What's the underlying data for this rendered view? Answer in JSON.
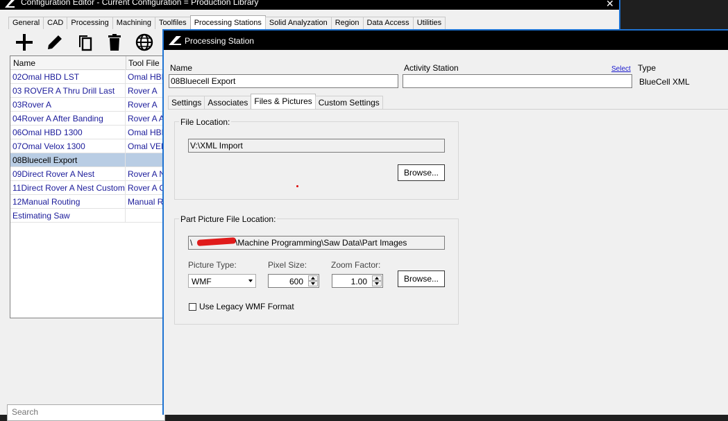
{
  "app": {
    "title": "Configuration Editor - Current Configuration = Production Library",
    "close_glyph": "✕"
  },
  "bg_tabs": [
    {
      "label": "General",
      "active": false
    },
    {
      "label": "CAD",
      "active": false
    },
    {
      "label": "Processing",
      "active": false
    },
    {
      "label": "Machining",
      "active": false
    },
    {
      "label": "Toolfiles",
      "active": false
    },
    {
      "label": "Processing Stations",
      "active": true
    },
    {
      "label": "Solid Analyzation",
      "active": false
    },
    {
      "label": "Region",
      "active": false
    },
    {
      "label": "Data Access",
      "active": false
    },
    {
      "label": "Utilities",
      "active": false
    }
  ],
  "toolbar": {
    "icons": [
      "add-icon",
      "edit-pencil-icon",
      "copy-icon",
      "delete-trash-icon",
      "globe-icon"
    ]
  },
  "grid": {
    "headers": [
      "Name",
      "Tool File"
    ],
    "rows": [
      {
        "name": "02Omal HBD LST",
        "tool_file": "Omal HBD"
      },
      {
        "name": "03 ROVER A Thru Drill Last",
        "tool_file": "Rover A"
      },
      {
        "name": "03Rover A",
        "tool_file": "Rover A"
      },
      {
        "name": "04Rover A After Banding",
        "tool_file": "Rover A A"
      },
      {
        "name": "06Omal HBD 1300",
        "tool_file": "Omal HBD"
      },
      {
        "name": "07Omal Velox 1300",
        "tool_file": "Omal VEL"
      },
      {
        "name": "08Bluecell Export",
        "tool_file": "",
        "selected": true
      },
      {
        "name": "09Direct Rover A Nest",
        "tool_file": "Rover A N"
      },
      {
        "name": "11Direct Rover A Nest Custom",
        "tool_file": "Rover A C"
      },
      {
        "name": "12Manual Routing",
        "tool_file": "Manual Ro"
      },
      {
        "name": "Estimating Saw",
        "tool_file": ""
      }
    ]
  },
  "search": {
    "placeholder": "Search"
  },
  "dialog": {
    "title": "Processing Station",
    "name_label": "Name",
    "name_value": "08Bluecell Export",
    "activity_label": "Activity Station",
    "activity_value": "",
    "select_link": "Select",
    "type_label": "Type",
    "type_value": "BlueCell XML",
    "tabs": [
      {
        "label": "Settings",
        "active": false
      },
      {
        "label": "Associates",
        "active": false
      },
      {
        "label": "Files & Pictures",
        "active": true
      },
      {
        "label": "Custom Settings",
        "active": false
      }
    ],
    "file_location": {
      "legend": "File Location:",
      "path": "V:\\XML Import",
      "browse_label": "Browse..."
    },
    "part_picture": {
      "legend": "Part Picture File Location:",
      "path_prefix": "\\",
      "path_suffix": "\\Machine Programming\\Saw Data\\Part Images",
      "picture_type_label": "Picture Type:",
      "picture_type_value": "WMF",
      "pixel_size_label": "Pixel Size:",
      "pixel_size_value": "600",
      "zoom_factor_label": "Zoom Factor:",
      "zoom_factor_value": "1.00",
      "browse_label": "Browse...",
      "legacy_label": "Use Legacy WMF Format",
      "legacy_checked": false
    }
  },
  "colors": {
    "accent_border": "#1e73d2",
    "link_text": "#1a1a9a",
    "selected_row": "#b9cde4",
    "redaction": "#e01b1b"
  }
}
